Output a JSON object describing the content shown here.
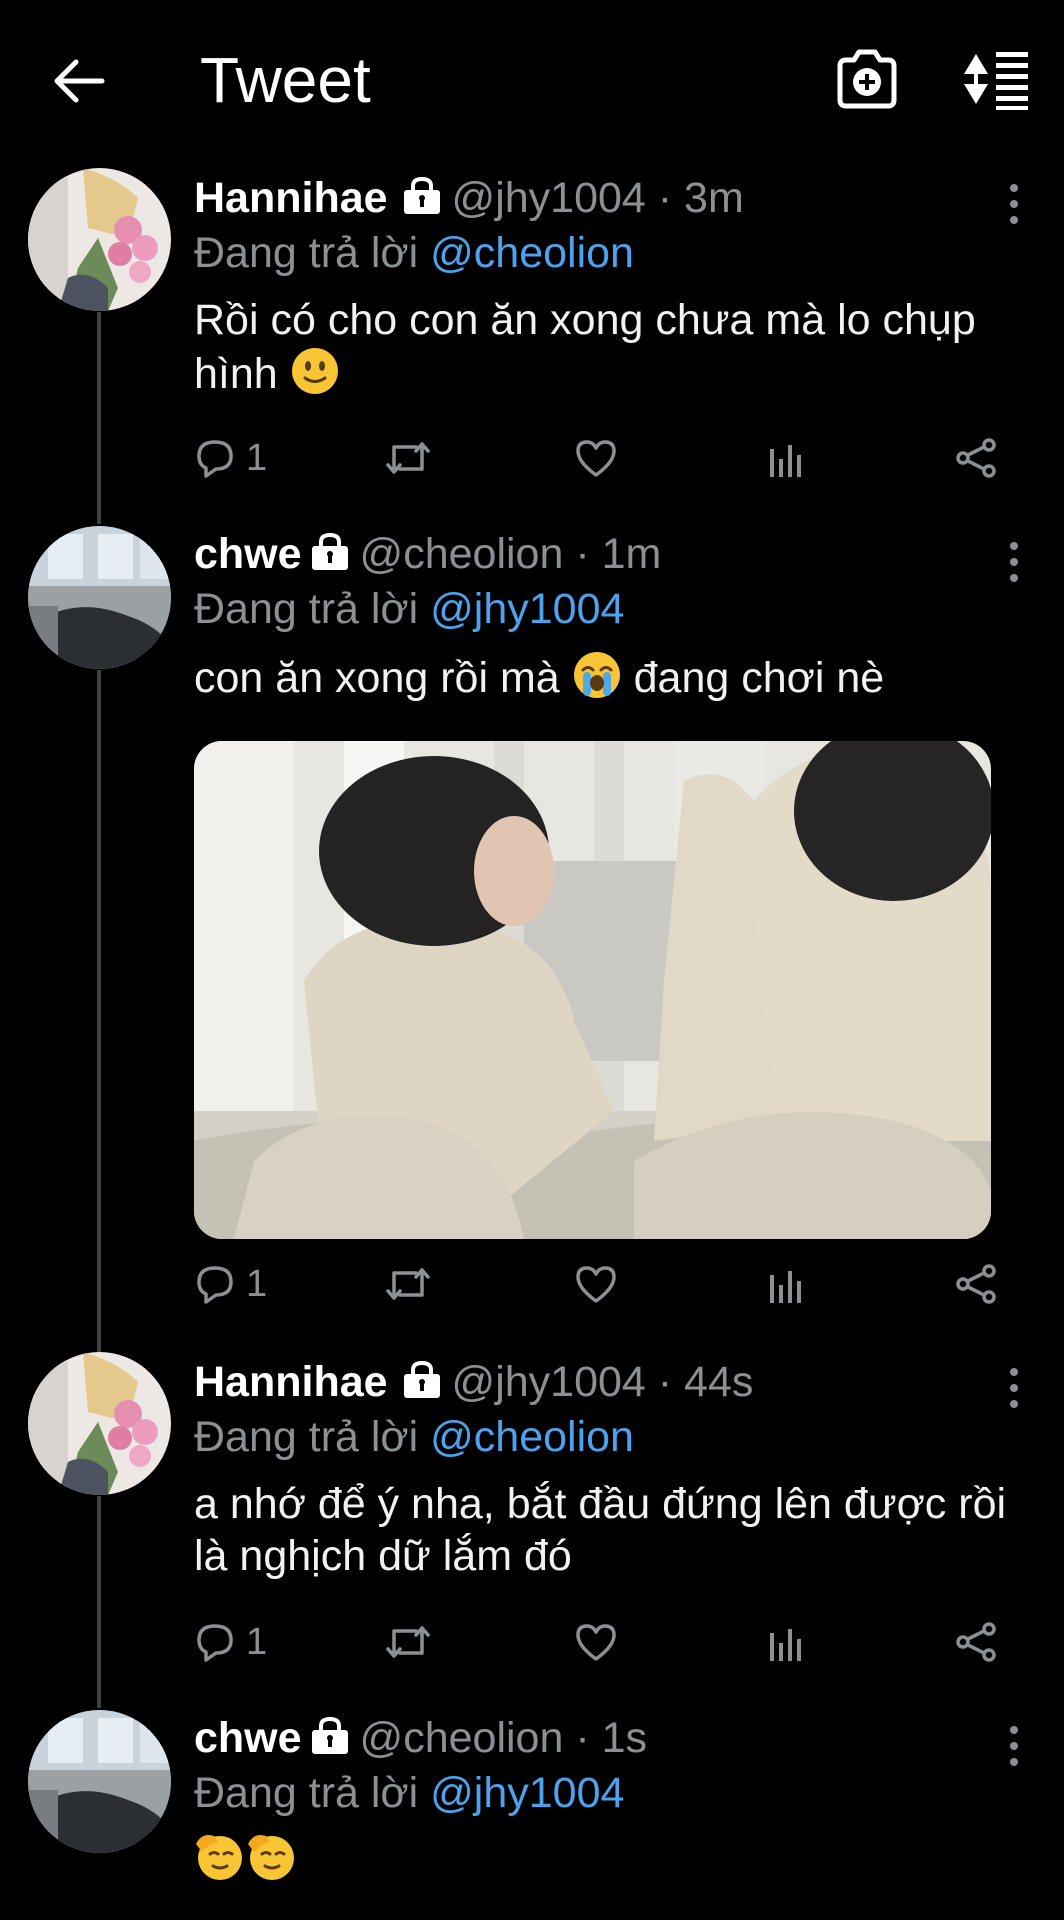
{
  "header": {
    "title": "Tweet"
  },
  "tweets": [
    {
      "name": "Hannihae",
      "handle": "@jhy1004",
      "time": "3m",
      "reply_prefix": "Đang trả lời",
      "reply_to": "@cheolion",
      "text": "Rồi có cho con ăn xong chưa mà lo chụp hình",
      "reply_count": "1"
    },
    {
      "name": "chwe",
      "handle": "@cheolion",
      "time": "1m",
      "reply_prefix": "Đang trả lời",
      "reply_to": "@jhy1004",
      "text": "con ăn xong rồi mà",
      "text_after": "đang chơi nè",
      "reply_count": "1"
    },
    {
      "name": "Hannihae",
      "handle": "@jhy1004",
      "time": "44s",
      "reply_prefix": "Đang trả lời",
      "reply_to": "@cheolion",
      "text": "a nhớ để ý nha, bắt đầu đứng lên được rồi là nghịch dữ lắm đó",
      "reply_count": "1"
    },
    {
      "name": "chwe",
      "handle": "@cheolion",
      "time": "1s",
      "reply_prefix": "Đang trả lời",
      "reply_to": "@jhy1004",
      "text": ""
    }
  ],
  "colors": {
    "background": "#000000",
    "mention": "#4ca2ed",
    "muted": "#8b9095"
  },
  "icons": [
    "back-arrow-icon",
    "camera-add-icon",
    "sort-icon",
    "lock-icon",
    "more-vertical-icon",
    "reply-icon",
    "retweet-icon",
    "like-icon",
    "analytics-icon",
    "share-icon"
  ]
}
